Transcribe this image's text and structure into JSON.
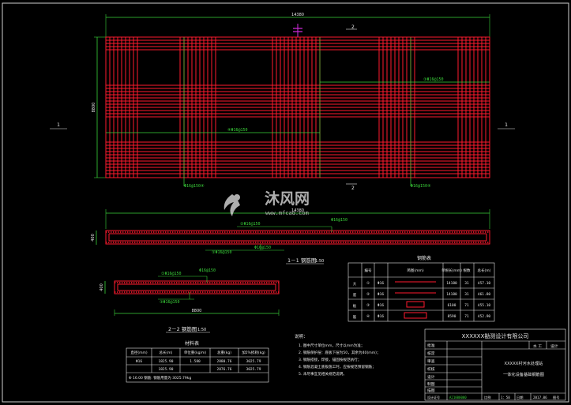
{
  "plan": {
    "overall_width_dim": "14380",
    "overall_height_dim": "8800",
    "section_marker_1": "1",
    "section_marker_2": "2",
    "rebar_label_center": "④Φ16@150",
    "rebar_label_right": "③Φ16@150",
    "rebar_label_bottom_left": "Φ16@150④",
    "rebar_label_bottom_right": "Φ16@150④"
  },
  "section_1": {
    "length_dim": "14380",
    "thickness_dim": "400",
    "bar_label_top": "②Φ16@150",
    "bar_label_top_right": "Φ16@150",
    "bar_label_bottom": "①Φ16@150",
    "bar_label_bottom_right": "Φ16@150",
    "title": "1－1 钢筋图",
    "scale": "1:50"
  },
  "section_2": {
    "length_dim": "8800",
    "thickness_dim": "400",
    "bar_label_top": "①Φ16@150",
    "bar_label_top_right": "Φ16@150",
    "bar_label_bottom": "③Φ16@150",
    "title": "2－2 钢筋图",
    "scale": "1:50"
  },
  "rebar_table": {
    "title": "钢筋表",
    "headers": [
      "",
      "编号",
      "",
      "简图(mm)",
      "单根长(mm)",
      "根数",
      "总长(m)"
    ],
    "group_label": [
      "大",
      "底",
      "板",
      "筋"
    ],
    "rows": [
      {
        "no": "①",
        "dia": "Φ16",
        "len": "14180",
        "count": "31",
        "total": "457.10"
      },
      {
        "no": "②",
        "dia": "Φ16",
        "len": "14180",
        "count": "31",
        "total": "461.80"
      },
      {
        "no": "③",
        "dia": "Φ16",
        "len": "6100",
        "count": "71",
        "total": "455.10"
      },
      {
        "no": "④",
        "dia": "Φ16",
        "len": "8590",
        "count": "71",
        "total": "452.90"
      }
    ]
  },
  "material_table": {
    "title": "材料表",
    "headers": [
      "直径(mm)",
      "总长(m)",
      "单位重(kg/m)",
      "总重(kg)",
      "加5%损耗(kg)"
    ],
    "rows": [
      [
        "Φ16",
        "1825.90",
        "1.580",
        "2880.76",
        "3025.79"
      ],
      [
        "",
        "1825.90",
        "",
        "2876.76",
        "3025.79"
      ]
    ],
    "footer": "Φ 16.00 钢筋: 钢筋用量为 3025.79kg"
  },
  "notes": {
    "title": "说明：",
    "items": [
      "1. 图中尺寸单位mm，尺寸以mm为准；",
      "2. 钢筋保护层：底板下层为50，其余为40(mm)；",
      "3. 钢筋搭接，焊接，锚固按规范执行；",
      "4. 钢筋混凝土底板施工时，应按规范预留钢筋；",
      "5. 未尽事宜见相关规范说明。"
    ]
  },
  "title_block": {
    "company": "XXXXXX勘测设计有限公司",
    "row_labels": [
      "批准",
      "核定",
      "审查",
      "校核",
      "设计",
      "制图",
      "描图",
      "设计证号"
    ],
    "right_labels": [
      "水 工",
      "部 分"
    ],
    "right_tags": [
      "设计",
      "初步"
    ],
    "drawing_title_1": "XXXXX村河水处理站",
    "drawing_title_2": "一体化设备基础钢筋图",
    "scale_label": "比例",
    "scale_value": "1：50",
    "date_label": "日期",
    "date_value": "2017.06",
    "sheet_label": "图号",
    "sheet_value": "XX-SJ-05-24"
  },
  "watermark": {
    "brand": "沐风网",
    "url": "www.mfcad.com"
  }
}
